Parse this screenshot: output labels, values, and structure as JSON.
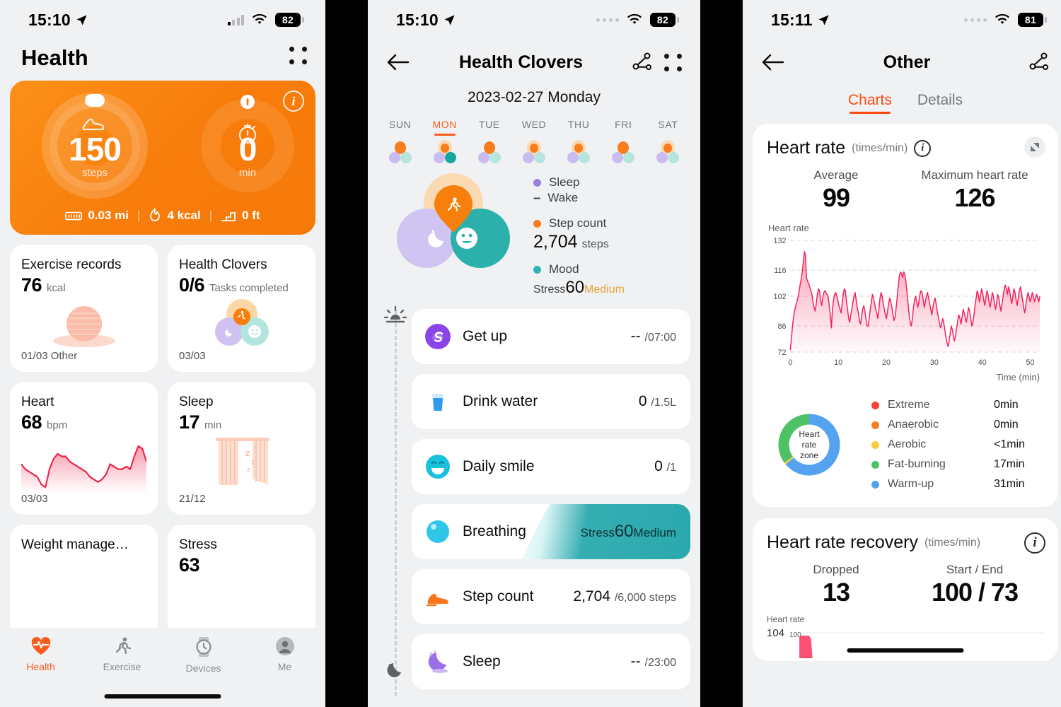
{
  "panel1": {
    "status": {
      "time": "15:10",
      "battery": "82",
      "signal_icon": "signal-bars-icon",
      "wifi_icon": "wifi-icon",
      "location_icon": "location-arrow-icon"
    },
    "title": "Health",
    "menu_icon": "grid-menu-icon",
    "summary": {
      "steps_value": "150",
      "steps_unit": "steps",
      "minutes_value": "0",
      "minutes_unit": "min",
      "distance": "0.03 mi",
      "calories": "4 kcal",
      "floors": "0 ft",
      "separator": "|",
      "info_icon": "info-icon",
      "shoe_icon": "shoe-icon",
      "stopwatch_icon": "stopwatch-icon",
      "ruler_icon": "ruler-icon",
      "flame_icon": "flame-icon",
      "stairs_icon": "stairs-icon",
      "accent": "#f77f0c"
    },
    "cards": [
      {
        "title": "Exercise records",
        "value": "76",
        "unit": "kcal",
        "footer": "01/03 Other",
        "art": "exercise-ball-icon"
      },
      {
        "title": "Health Clovers",
        "value": "0/6",
        "unit": "Tasks completed",
        "footer": "03/03",
        "art": "clover-icon"
      },
      {
        "title": "Heart",
        "value": "68",
        "unit": "bpm",
        "footer": "03/03",
        "art": "heart-rate-sparkline"
      },
      {
        "title": "Sleep",
        "value": "17",
        "unit": "min",
        "footer": "21/12",
        "art": "curtain-sleep-icon"
      },
      {
        "title": "Weight manage…",
        "value": "",
        "unit": "",
        "footer": "",
        "art": ""
      },
      {
        "title": "Stress",
        "value": "63",
        "unit": "",
        "footer": "",
        "art": ""
      }
    ],
    "tabs": [
      {
        "label": "Health",
        "icon": "heart-pulse-icon",
        "active": true
      },
      {
        "label": "Exercise",
        "icon": "running-icon",
        "active": false
      },
      {
        "label": "Devices",
        "icon": "watch-icon",
        "active": false
      },
      {
        "label": "Me",
        "icon": "person-icon",
        "active": false
      }
    ]
  },
  "panel2": {
    "status": {
      "time": "15:10",
      "battery": "82",
      "signal_icon": "signal-dots-icon",
      "wifi_icon": "wifi-icon",
      "location_icon": "location-arrow-icon"
    },
    "back_icon": "back-arrow-icon",
    "title": "Health Clovers",
    "share_icon": "share-node-icon",
    "menu_icon": "grid-menu-icon",
    "date": "2023-02-27 Monday",
    "week": [
      {
        "name": "SUN",
        "active": false,
        "top_filled": true,
        "right_filled": false
      },
      {
        "name": "MON",
        "active": true,
        "top_filled": false,
        "right_filled": true
      },
      {
        "name": "TUE",
        "active": false,
        "top_filled": true,
        "right_filled": false
      },
      {
        "name": "WED",
        "active": false,
        "top_filled": false,
        "right_filled": false
      },
      {
        "name": "THU",
        "active": false,
        "top_filled": false,
        "right_filled": false
      },
      {
        "name": "FRI",
        "active": false,
        "top_filled": true,
        "right_filled": false
      },
      {
        "name": "SAT",
        "active": false,
        "top_filled": false,
        "right_filled": false
      }
    ],
    "legend": {
      "sleep_label": "Sleep",
      "sleep_color": "#9a7fe0",
      "wake_label": "Wake",
      "wake_value": "--",
      "step_label": "Step count",
      "step_color": "#f97d1c",
      "step_value": "2,704",
      "step_unit": "steps",
      "mood_label": "Mood",
      "mood_color": "#2eb3b3",
      "stress_prefix": "Stress",
      "stress_value": "60",
      "stress_level": "Medium"
    },
    "timeline_top_icon": "sunrise-icon",
    "timeline_bottom_icon": "moon-icon",
    "tasks": [
      {
        "name": "Get up",
        "icon": "sunrise-circle-icon",
        "value": "--",
        "target": "/07:00"
      },
      {
        "name": "Drink water",
        "icon": "water-glass-icon",
        "value": "0",
        "target": "/1.5L"
      },
      {
        "name": "Daily smile",
        "icon": "smile-icon",
        "value": "0",
        "target": "/1"
      },
      {
        "name": "Breathing",
        "icon": "breathing-icon",
        "value": "",
        "target": "",
        "stress_prefix": "Stress",
        "stress_value": "60",
        "stress_level": "Medium",
        "highlight": true
      },
      {
        "name": "Step count",
        "icon": "sneaker-icon",
        "value": "2,704",
        "target": "/6,000 steps"
      },
      {
        "name": "Sleep",
        "icon": "sleep-moon-icon",
        "value": "--",
        "target": "/23:00"
      }
    ]
  },
  "panel3": {
    "status": {
      "time": "15:11",
      "battery": "81",
      "signal_icon": "signal-dots-icon",
      "wifi_icon": "wifi-icon",
      "location_icon": "location-arrow-icon"
    },
    "back_icon": "back-arrow-icon",
    "title": "Other",
    "share_icon": "share-node-icon",
    "tabs": [
      {
        "label": "Charts",
        "active": true
      },
      {
        "label": "Details",
        "active": false
      }
    ],
    "hr_card": {
      "title": "Heart rate",
      "unit": "(times/min)",
      "info_icon": "info-icon",
      "expand_icon": "expand-icon",
      "stats": [
        {
          "label": "Average",
          "value": "99"
        },
        {
          "label": "Maximum heart rate",
          "value": "126"
        }
      ],
      "zone_center": [
        "Heart",
        "rate",
        "zone"
      ],
      "zones": [
        {
          "name": "Extreme",
          "value": "0min",
          "color": "#f44336"
        },
        {
          "name": "Anaerobic",
          "value": "0min",
          "color": "#f08024"
        },
        {
          "name": "Aerobic",
          "value": "<1min",
          "color": "#f5cd3e"
        },
        {
          "name": "Fat-burning",
          "value": "17min",
          "color": "#4cc264"
        },
        {
          "name": "Warm-up",
          "value": "31min",
          "color": "#54a2f0"
        }
      ]
    },
    "recovery_card": {
      "title": "Heart rate recovery",
      "unit": "(times/min)",
      "info_icon": "info-icon",
      "stats": [
        {
          "label": "Dropped",
          "value": "13"
        },
        {
          "label": "Start / End",
          "value": "100 / 73"
        }
      ],
      "axis_label": "Heart rate",
      "axis_max": "104",
      "axis_sub": "100"
    }
  },
  "chart_data": [
    {
      "type": "area",
      "title": "Heart rate",
      "ylabel": "Heart rate",
      "xlabel": "Time (min)",
      "unit": "times/min",
      "ylim": [
        72,
        132
      ],
      "yticks": [
        72,
        86,
        102,
        116,
        132
      ],
      "xlim": [
        0,
        52
      ],
      "xticks": [
        0,
        10,
        20,
        30,
        40,
        50
      ],
      "grid": true,
      "average": 99,
      "maximum": 126,
      "color": "#f5215a",
      "values": [
        73,
        79,
        86,
        91,
        94,
        97,
        99,
        101,
        104,
        108,
        111,
        115,
        120,
        126,
        124,
        112,
        110,
        109,
        107,
        105,
        103,
        99,
        96,
        94,
        98,
        103,
        106,
        105,
        100,
        97,
        101,
        104,
        105,
        104,
        103,
        102,
        97,
        92,
        85,
        95,
        100,
        103,
        104,
        102,
        100,
        97,
        95,
        93,
        98,
        103,
        106,
        105,
        99,
        95,
        90,
        88,
        92,
        95,
        99,
        102,
        104,
        100,
        96,
        93,
        89,
        87,
        91,
        95,
        97,
        94,
        90,
        86,
        86,
        90,
        95,
        99,
        103,
        101,
        98,
        95,
        93,
        90,
        95,
        101,
        104,
        102,
        98,
        95,
        92,
        90,
        94,
        98,
        101,
        99,
        96,
        92,
        89,
        91,
        96,
        102,
        108,
        113,
        115,
        114,
        112,
        115,
        114,
        110,
        104,
        98,
        92,
        88,
        86,
        90,
        96,
        100,
        102,
        99,
        96,
        99,
        103,
        105,
        104,
        100,
        96,
        99,
        102,
        104,
        101,
        98,
        95,
        92,
        96,
        99,
        101,
        98,
        94,
        91,
        88,
        85,
        87,
        90,
        88,
        84,
        80,
        77,
        75,
        78,
        82,
        86,
        84,
        80,
        78,
        81,
        85,
        89,
        92,
        90,
        87,
        91,
        95,
        93,
        90,
        88,
        92,
        96,
        94,
        90,
        86,
        88,
        92,
        97,
        101,
        105,
        103,
        99,
        102,
        106,
        104,
        100,
        97,
        101,
        105,
        103,
        99,
        96,
        100,
        104,
        102,
        98,
        95,
        99,
        103,
        101,
        97,
        94,
        98,
        102,
        106,
        108,
        106,
        103,
        107,
        105,
        101,
        98,
        102,
        106,
        104,
        100,
        97,
        101,
        105,
        107,
        104,
        100,
        96,
        93,
        97,
        101,
        104,
        102,
        99,
        101,
        104,
        102,
        99,
        101,
        103,
        101,
        99,
        102
      ]
    },
    {
      "type": "area",
      "title": "Heart rate recovery",
      "ylabel": "Heart rate",
      "unit": "times/min",
      "yticks": [
        104,
        100
      ],
      "dropped": 13,
      "start": 100,
      "end": 73,
      "color": "#f5215a",
      "values": [
        100,
        104,
        98,
        88
      ]
    },
    {
      "type": "area",
      "title": "Heart sparkline (card)",
      "ylabel": "",
      "xlabel": "",
      "color": "#f02045",
      "values": [
        72,
        70,
        69,
        68,
        67,
        64,
        63,
        70,
        74,
        76,
        75,
        75,
        73,
        72,
        71,
        70,
        69,
        67,
        66,
        65,
        66,
        68,
        72,
        71,
        70,
        70,
        71,
        70,
        75,
        79,
        78,
        73
      ]
    }
  ]
}
